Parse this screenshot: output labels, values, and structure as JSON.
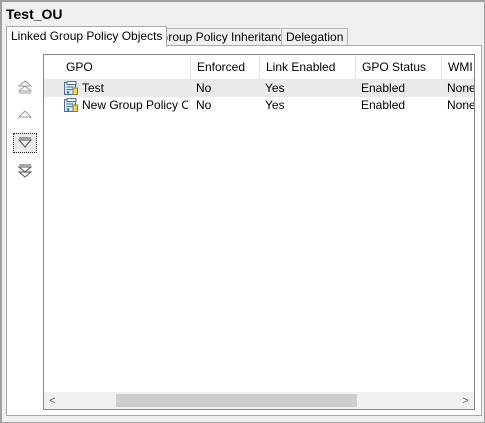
{
  "page": {
    "title": "Test_OU"
  },
  "tabs": [
    {
      "label": "Linked Group Policy Objects",
      "active": true
    },
    {
      "label": "Group Policy Inheritance",
      "active": false
    },
    {
      "label": "Delegation",
      "active": false
    }
  ],
  "order_buttons": [
    {
      "name": "move-to-top-icon"
    },
    {
      "name": "move-up-icon"
    },
    {
      "name": "move-down-icon"
    },
    {
      "name": "move-to-bottom-icon"
    }
  ],
  "table": {
    "columns": [
      "GPO",
      "Enforced",
      "Link Enabled",
      "GPO Status",
      "WMI"
    ],
    "rows": [
      {
        "gpo": "Test",
        "enforced": "No",
        "link_enabled": "Yes",
        "status": "Enabled",
        "wmi": "None",
        "icon": "gpo-icon"
      },
      {
        "gpo": "New Group Policy O...",
        "enforced": "No",
        "link_enabled": "Yes",
        "status": "Enabled",
        "wmi": "None",
        "icon": "gpo-icon"
      }
    ]
  },
  "scrollbar": {
    "left_arrow": "<",
    "right_arrow": ">"
  },
  "colors": {
    "selected_row": "#eaeaea",
    "border": "#a9a9a9"
  }
}
